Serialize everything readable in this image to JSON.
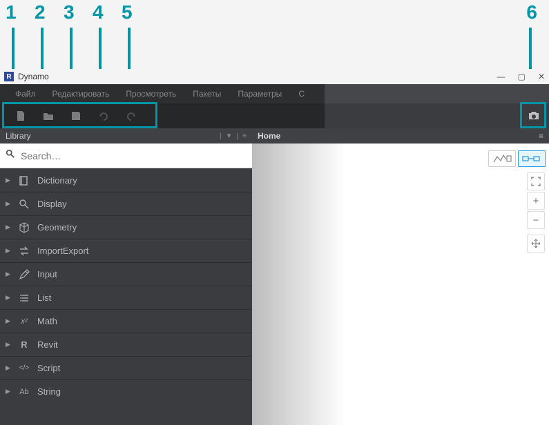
{
  "annotations": {
    "n1": "1",
    "n2": "2",
    "n3": "3",
    "n4": "4",
    "n5": "5",
    "n6": "6"
  },
  "title": "Dynamo",
  "menu": {
    "file": "Файл",
    "edit": "Редактировать",
    "view": "Просмотреть",
    "packages": "Пакеты",
    "params": "Параметры",
    "help": "С"
  },
  "library": {
    "header": "Library",
    "search_placeholder": "Search…",
    "items": [
      {
        "label": "Dictionary",
        "icon": "book"
      },
      {
        "label": "Display",
        "icon": "magnify"
      },
      {
        "label": "Geometry",
        "icon": "cube"
      },
      {
        "label": "ImportExport",
        "icon": "swap"
      },
      {
        "label": "Input",
        "icon": "pencil"
      },
      {
        "label": "List",
        "icon": "list"
      },
      {
        "label": "Math",
        "icon": "math"
      },
      {
        "label": "Revit",
        "icon": "revit"
      },
      {
        "label": "Script",
        "icon": "code"
      },
      {
        "label": "String",
        "icon": "text"
      }
    ]
  },
  "canvas": {
    "breadcrumb": "Home"
  }
}
